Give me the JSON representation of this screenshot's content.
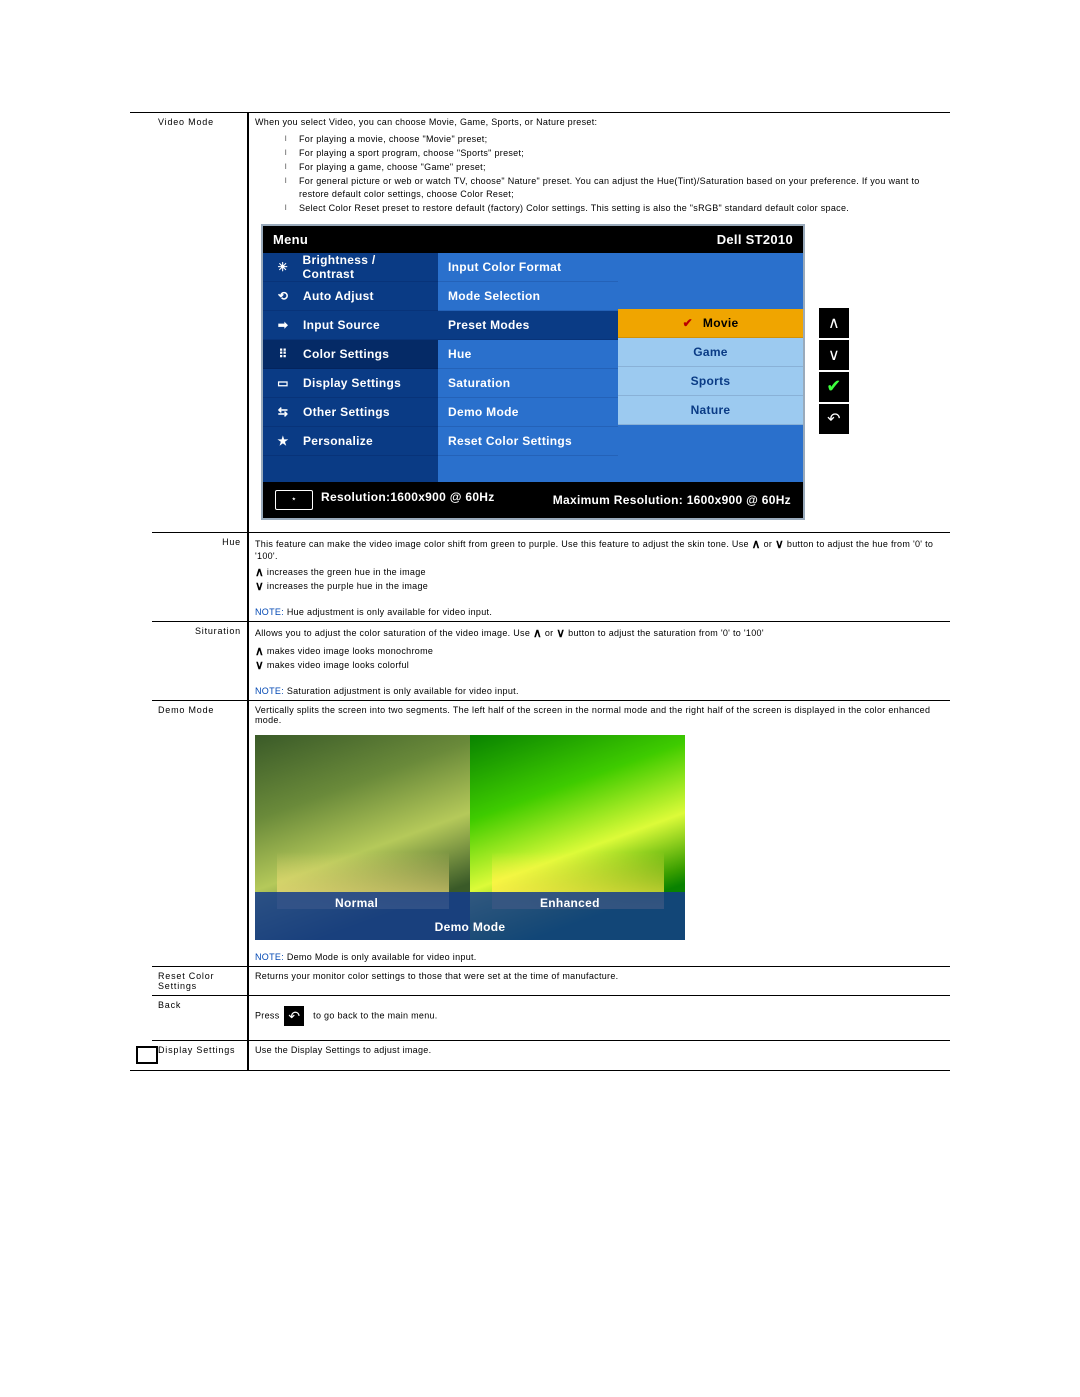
{
  "rows": {
    "video_mode": {
      "label": "Video Mode",
      "intro": "When you select Video, you can choose Movie, Game, Sports, or Nature preset:",
      "bullets": [
        "For playing a movie, choose \"Movie\" preset;",
        "For playing a sport program, choose \"Sports\" preset;",
        "For playing a game, choose \"Game\" preset;",
        "For general picture or web or watch TV, choose\" Nature\" preset. You can adjust the Hue(Tint)/Saturation based on your preference. If you want to restore default color settings, choose Color Reset;",
        "Select Color Reset preset to restore default (factory) Color settings. This setting is also the \"sRGB\" standard default color space."
      ]
    },
    "hue": {
      "label": "Hue",
      "p1a": "This feature can make the video image color shift from green to purple. Use this feature to adjust the skin tone. Use",
      "p1b": "or",
      "p1c": "button to adjust the hue from '0' to '100'.",
      "inc": "increases the green hue in the image",
      "dec": "increases the purple hue in the image",
      "note_label": "NOTE:",
      "note": " Hue adjustment is only available for video input."
    },
    "saturation": {
      "label": "Situration",
      "p1a": "Allows you to adjust the color saturation of the video image. Use ",
      "p1b": " or ",
      "p1c": "button to adjust the saturation from '0' to '100'",
      "inc": "makes video image looks monochrome",
      "dec": "makes video image looks colorful",
      "note_label": "NOTE:",
      "note": " Saturation adjustment is only available for video input."
    },
    "demo": {
      "label": "Demo Mode",
      "p1": "Vertically splits the screen into two segments. The left half of the screen in the normal mode and the right half of the screen is displayed in the color enhanced mode.",
      "overlay_normal": "Normal",
      "overlay_enhanced": "Enhanced",
      "overlay_title": "Demo  Mode",
      "note_label": "NOTE:",
      "note": " Demo Mode is only available for video input."
    },
    "reset": {
      "label": "Reset Color Settings",
      "p1": "Returns your monitor color settings to those that were set at the time of manufacture."
    },
    "back": {
      "label": "Back",
      "press": "Press",
      "rest": "to go back to the main menu."
    },
    "display": {
      "label": "Display Settings",
      "p1": "Use the Display Settings to adjust image."
    }
  },
  "osd": {
    "header_left": "Menu",
    "header_right": "Dell ST2010",
    "main_items": [
      "Brightness / Contrast",
      "Auto Adjust",
      "Input Source",
      "Color Settings",
      "Display Settings",
      "Other Settings",
      "Personalize"
    ],
    "sub_items": [
      "Input Color Format",
      "Mode Selection",
      "Preset Modes",
      "Hue",
      "Saturation",
      "Demo Mode",
      "Reset Color Settings"
    ],
    "preset_items": [
      "Movie",
      "Game",
      "Sports",
      "Nature"
    ],
    "footer_res": "Resolution:1600x900 @ 60Hz",
    "footer_max": "Maximum Resolution: 1600x900 @ 60Hz"
  }
}
